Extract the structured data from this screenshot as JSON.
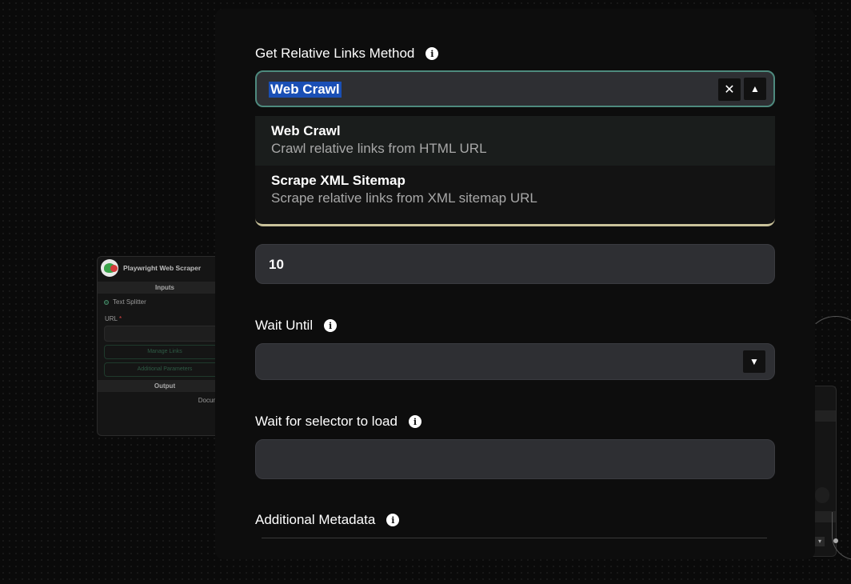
{
  "node": {
    "title": "Playwright Web Scraper",
    "inputs_header": "Inputs",
    "text_splitter": "Text Splitter",
    "url_label": "URL",
    "url_required": "*",
    "manage_links": "Manage Links",
    "additional_parameters": "Additional Parameters",
    "output_header": "Output",
    "output_item": "Documen"
  },
  "dialog": {
    "relative_links": {
      "label": "Get Relative Links Method",
      "value": "Web Crawl",
      "options": [
        {
          "title": "Web Crawl",
          "description": "Crawl relative links from HTML URL"
        },
        {
          "title": "Scrape XML Sitemap",
          "description": "Scrape relative links from XML sitemap URL"
        }
      ]
    },
    "limit": {
      "value": "10"
    },
    "wait_until": {
      "label": "Wait Until",
      "value": ""
    },
    "wait_selector": {
      "label": "Wait for selector to load",
      "value": ""
    },
    "additional_metadata": {
      "label": "Additional Metadata"
    }
  },
  "icons": {
    "info": "i",
    "clear": "✕",
    "collapse": "▲",
    "expand": "▼",
    "node2_select": "▾"
  }
}
